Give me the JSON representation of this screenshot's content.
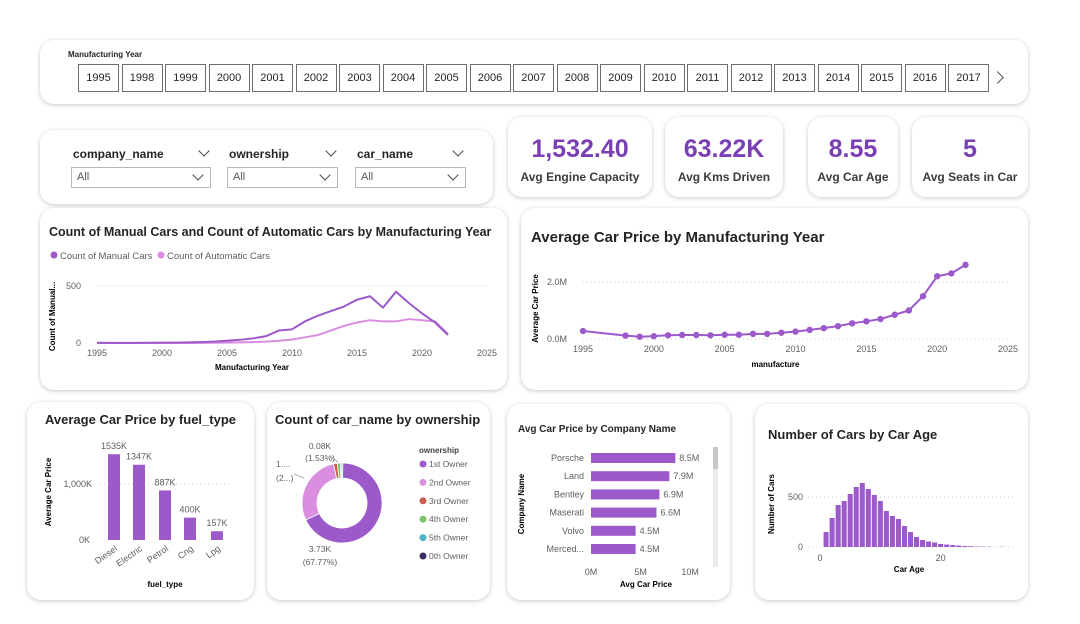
{
  "year_slicer": {
    "label": "Manufacturing Year",
    "years": [
      "1995",
      "1998",
      "1999",
      "2000",
      "2001",
      "2002",
      "2003",
      "2004",
      "2005",
      "2006",
      "2007",
      "2008",
      "2009",
      "2010",
      "2011",
      "2012",
      "2013",
      "2014",
      "2015",
      "2016",
      "2017"
    ]
  },
  "filters": [
    {
      "label": "company_name",
      "value": "All"
    },
    {
      "label": "ownership",
      "value": "All"
    },
    {
      "label": "car_name",
      "value": "All"
    }
  ],
  "kpis": [
    {
      "value": "1,532.40",
      "label": "Avg Engine Capacity"
    },
    {
      "value": "63.22K",
      "label": "Avg Kms Driven"
    },
    {
      "value": "8.55",
      "label": "Avg Car Age"
    },
    {
      "value": "5",
      "label": "Avg Seats in Car"
    }
  ],
  "colors": {
    "accent": "#7b3fb4",
    "series_dark": "#9b59c9",
    "series_light": "#d98ee0",
    "bar": "#9b59c9"
  },
  "chart_data": [
    {
      "id": "manual_auto",
      "type": "line",
      "title": "Count of Manual Cars and Count of Automatic Cars by Manufacturing Year",
      "xlabel": "Manufacturing Year",
      "ylabel": "Count of Manual...",
      "xlim": [
        1995,
        2025
      ],
      "ylim": [
        0,
        500
      ],
      "xticks": [
        "1995",
        "2000",
        "2005",
        "2010",
        "2015",
        "2020",
        "2025"
      ],
      "yticks": [
        "0",
        "500"
      ],
      "legend_position": "top-left",
      "x": [
        1995,
        1996,
        1997,
        1998,
        1999,
        2000,
        2001,
        2002,
        2003,
        2004,
        2005,
        2006,
        2007,
        2008,
        2009,
        2010,
        2011,
        2012,
        2013,
        2014,
        2015,
        2016,
        2017,
        2018,
        2019,
        2020,
        2021,
        2022
      ],
      "series": [
        {
          "name": "Count of Manual Cars",
          "color": "#9b59c9",
          "values": [
            2,
            1,
            1,
            1,
            2,
            3,
            3,
            5,
            8,
            12,
            20,
            28,
            40,
            60,
            110,
            120,
            190,
            240,
            280,
            320,
            380,
            410,
            310,
            450,
            350,
            260,
            180,
            70
          ]
        },
        {
          "name": "Count of Automatic Cars",
          "color": "#d98ee0",
          "values": [
            0,
            0,
            0,
            0,
            0,
            0,
            0,
            0,
            1,
            2,
            3,
            5,
            8,
            12,
            20,
            30,
            50,
            70,
            110,
            150,
            180,
            200,
            190,
            190,
            210,
            200,
            190,
            80
          ]
        }
      ]
    },
    {
      "id": "price_year",
      "type": "line",
      "title": "Average Car Price by Manufacturing Year",
      "xlabel": "manufacture",
      "ylabel": "Average Car Price",
      "xlim": [
        1995,
        2025
      ],
      "ylim": [
        0,
        2.7
      ],
      "xticks": [
        "1995",
        "2000",
        "2005",
        "2010",
        "2015",
        "2020",
        "2025"
      ],
      "yticks": [
        "0.0M",
        "2.0M"
      ],
      "x": [
        1995,
        1998,
        1999,
        2000,
        2001,
        2002,
        2003,
        2004,
        2005,
        2006,
        2007,
        2008,
        2009,
        2010,
        2011,
        2012,
        2013,
        2014,
        2015,
        2016,
        2017,
        2018,
        2019,
        2020,
        2021,
        2022
      ],
      "values": [
        0.28,
        0.12,
        0.08,
        0.1,
        0.13,
        0.14,
        0.14,
        0.13,
        0.15,
        0.15,
        0.18,
        0.18,
        0.22,
        0.26,
        0.32,
        0.38,
        0.45,
        0.55,
        0.62,
        0.7,
        0.85,
        1.0,
        1.5,
        2.2,
        2.3,
        2.6
      ]
    },
    {
      "id": "fuel",
      "type": "bar",
      "title": "Average Car Price by fuel_type",
      "xlabel": "fuel_type",
      "ylabel": "Average Car Price",
      "ylim": [
        0,
        1700
      ],
      "yticks": [
        "0K",
        "1,000K"
      ],
      "categories": [
        "Diesel",
        "Electric",
        "Petrol",
        "Cng",
        "Lpg"
      ],
      "values": [
        1535,
        1347,
        887,
        400,
        157
      ],
      "data_labels": [
        "1535K",
        "1347K",
        "887K",
        "400K",
        "157K"
      ]
    },
    {
      "id": "ownership",
      "type": "pie",
      "title": "Count of car_name by ownership",
      "legend_title": "ownership",
      "legend_position": "right",
      "slices": [
        {
          "name": "1st Owner",
          "value": 67.77,
          "color": "#9b59c9"
        },
        {
          "name": "2nd Owner",
          "value": 28.5,
          "color": "#d98ee0"
        },
        {
          "name": "3rd Owner",
          "value": 1.53,
          "color": "#c8604e"
        },
        {
          "name": "4th Owner",
          "value": 1.2,
          "color": "#7cc36b"
        },
        {
          "name": "5th Owner",
          "value": 0.6,
          "color": "#4fb3c8"
        },
        {
          "name": "0th Owner",
          "value": 0.4,
          "color": "#3e2a63"
        }
      ],
      "data_labels": [
        {
          "text": "0.08K",
          "sub": "(1.53%)"
        },
        {
          "text": "1....",
          "sub": "(2...)"
        },
        {
          "text": "3.73K",
          "sub": "(67.77%)"
        }
      ]
    },
    {
      "id": "company",
      "type": "bar",
      "orientation": "horizontal",
      "title": "Avg Car Price by Company Name",
      "xlabel": "Avg Car Price",
      "ylabel": "Company Name",
      "xlim": [
        0,
        12
      ],
      "xticks": [
        "0M",
        "5M",
        "10M"
      ],
      "categories": [
        "Porsche",
        "Land",
        "Bentley",
        "Maserati",
        "Volvo",
        "Merced..."
      ],
      "values": [
        8.5,
        7.9,
        6.9,
        6.6,
        4.5,
        4.5
      ],
      "data_labels": [
        "8.5M",
        "7.9M",
        "6.9M",
        "6.6M",
        "4.5M",
        "4.5M"
      ]
    },
    {
      "id": "age",
      "type": "bar",
      "title": "Number of Cars by Car Age",
      "xlabel": "Car Age",
      "ylabel": "Number of Cars",
      "xlim": [
        -2,
        32
      ],
      "ylim": [
        0,
        700
      ],
      "xticks": [
        "0",
        "20"
      ],
      "yticks": [
        "0",
        "500"
      ],
      "x": [
        1,
        2,
        3,
        4,
        5,
        6,
        7,
        8,
        9,
        10,
        11,
        12,
        13,
        14,
        15,
        16,
        17,
        18,
        19,
        20,
        21,
        22,
        23,
        24,
        25,
        26,
        27,
        28,
        30
      ],
      "values": [
        150,
        290,
        420,
        460,
        530,
        600,
        640,
        580,
        520,
        460,
        360,
        310,
        280,
        210,
        150,
        100,
        70,
        55,
        45,
        30,
        25,
        20,
        15,
        10,
        8,
        5,
        4,
        3,
        2
      ]
    }
  ]
}
